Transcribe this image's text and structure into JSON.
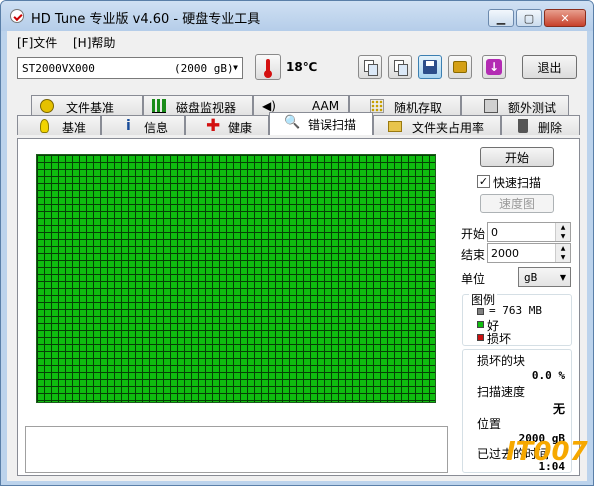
{
  "window": {
    "title": "HD Tune 专业版 v4.60 - 硬盘专业工具"
  },
  "menu": [
    {
      "label": "[F]文件"
    },
    {
      "label": "[H]帮助"
    }
  ],
  "toolbar": {
    "drive": {
      "name": "ST2000VX000",
      "size": "(2000 gB)"
    },
    "temperature": "18℃",
    "exit_label": "退出"
  },
  "tabs_top": [
    {
      "label": "文件基准",
      "icon": "gear-icon"
    },
    {
      "label": "磁盘监视器",
      "icon": "bar-chart-icon"
    },
    {
      "label": "AAM",
      "icon": "speaker-icon"
    },
    {
      "label": "随机存取",
      "icon": "dots-grid-icon"
    },
    {
      "label": "额外测试",
      "icon": "calculator-icon"
    }
  ],
  "tabs_bottom": [
    {
      "label": "基准",
      "icon": "bulb-icon"
    },
    {
      "label": "信息",
      "icon": "info-icon"
    },
    {
      "label": "健康",
      "icon": "plus-cross-icon"
    },
    {
      "label": "错误扫描",
      "icon": "magnifier-icon",
      "selected": true
    },
    {
      "label": "文件夹占用率",
      "icon": "folder-icon"
    },
    {
      "label": "删除",
      "icon": "trash-icon"
    }
  ],
  "scan": {
    "start_button": "开始",
    "quick_scan_label": "快速扫描",
    "quick_scan_checked": true,
    "map_button": "速度图",
    "start_label": "开始",
    "start_value": "0",
    "end_label": "结束",
    "end_value": "2000",
    "unit_label": "单位",
    "unit_value": "gB",
    "legend": {
      "title": "图例",
      "block_size": "= 763 MB",
      "good": "好",
      "bad": "损坏"
    },
    "stats": {
      "damaged_label": "损坏的块",
      "damaged_value": "0.0 %",
      "speed_label": "扫描速度",
      "speed_value": "无",
      "position_label": "位置",
      "position_value": "2000 gB",
      "elapsed_label": "已过去的时间",
      "elapsed_value": "1:04"
    }
  },
  "colors": {
    "good": "#0fbd0f",
    "bad": "#cc1111",
    "block": "#808080",
    "watermark": "#f6a800"
  },
  "watermark": "IT007"
}
